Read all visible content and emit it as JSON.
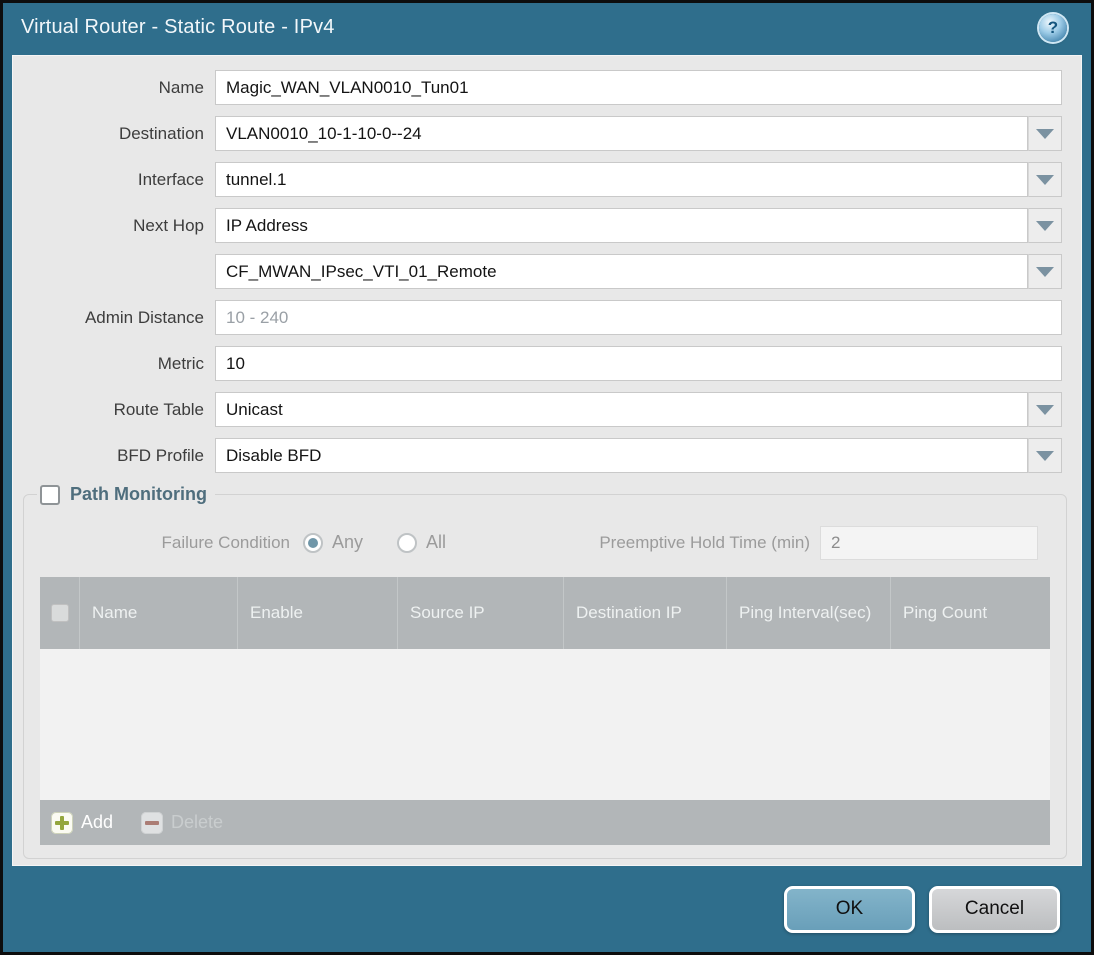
{
  "dialog": {
    "title": "Virtual Router - Static Route - IPv4",
    "help_glyph": "?"
  },
  "form": {
    "fields": [
      {
        "label": "Name",
        "value": "Magic_WAN_VLAN0010_Tun01",
        "type": "text"
      },
      {
        "label": "Destination",
        "value": "VLAN0010_10-1-10-0--24",
        "type": "dropdown"
      },
      {
        "label": "Interface",
        "value": "tunnel.1",
        "type": "dropdown"
      },
      {
        "label": "Next Hop",
        "value": "IP Address",
        "type": "dropdown"
      },
      {
        "label": "",
        "value": "CF_MWAN_IPsec_VTI_01_Remote",
        "type": "dropdown"
      },
      {
        "label": "Admin Distance",
        "value": "",
        "placeholder": "10 - 240",
        "type": "text"
      },
      {
        "label": "Metric",
        "value": "10",
        "type": "text"
      },
      {
        "label": "Route Table",
        "value": "Unicast",
        "type": "dropdown"
      },
      {
        "label": "BFD Profile",
        "value": "Disable BFD",
        "type": "dropdown"
      }
    ]
  },
  "path_monitoring": {
    "title": "Path Monitoring",
    "checked": false,
    "failure_condition_label": "Failure Condition",
    "options": [
      {
        "label": "Any",
        "selected": true
      },
      {
        "label": "All",
        "selected": false
      }
    ],
    "preemptive_label": "Preemptive Hold Time (min)",
    "preemptive_value": "2",
    "table": {
      "columns": [
        "Name",
        "Enable",
        "Source IP",
        "Destination IP",
        "Ping Interval(sec)",
        "Ping Count"
      ],
      "rows": []
    },
    "add_label": "Add",
    "delete_label": "Delete"
  },
  "footer": {
    "ok_label": "OK",
    "cancel_label": "Cancel"
  },
  "colors": {
    "frame_teal": "#2f6e8c",
    "content_bg": "#e8e8e8",
    "table_header_gray": "#b2b6b8",
    "ok_button_blue": "#76a9c0",
    "add_plus_green": "#94a63d",
    "delete_minus_red": "#ab7d75",
    "radio_selected_dot": "#6f96a8"
  }
}
